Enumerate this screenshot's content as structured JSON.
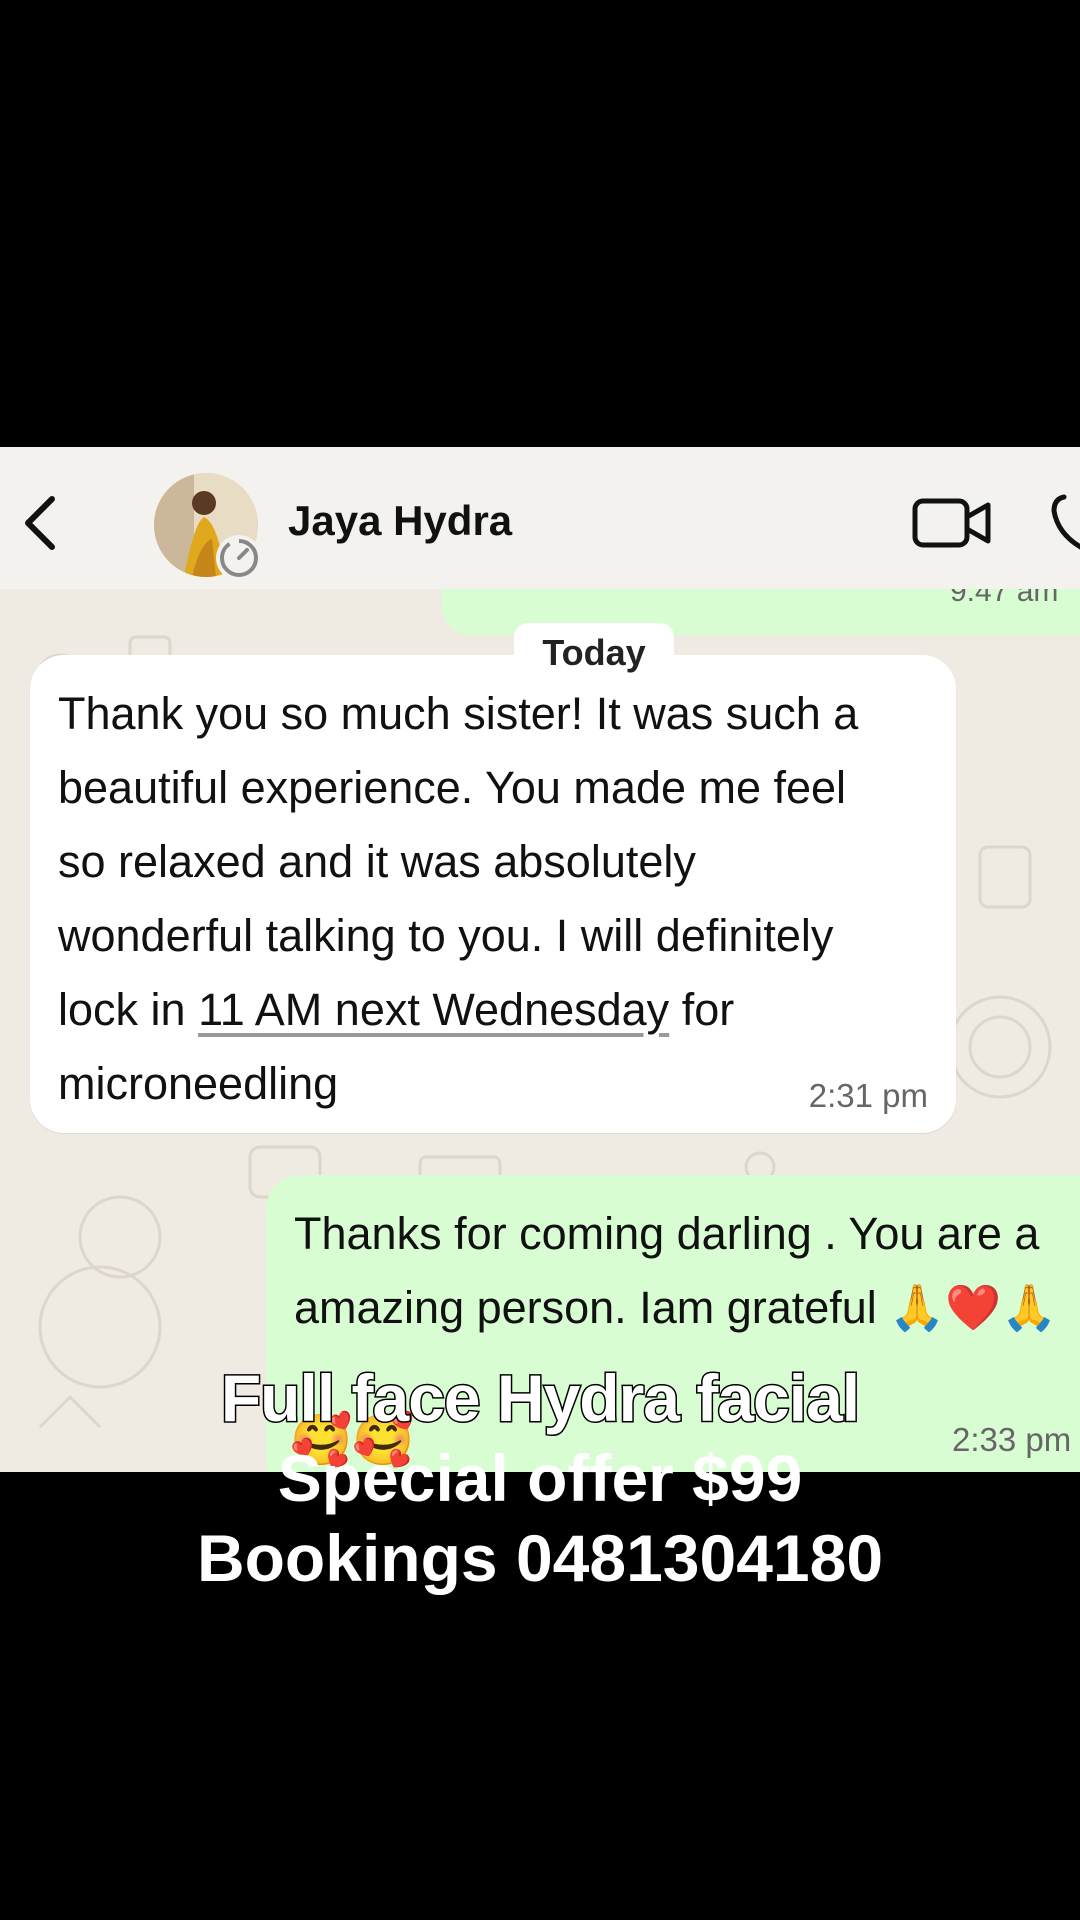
{
  "header": {
    "contact_name": "Jaya Hydra",
    "back_icon": "chevron-left-icon",
    "video_icon": "video-camera-icon",
    "phone_icon": "phone-icon"
  },
  "chat": {
    "previous_message_time_partial": "9:47 am",
    "date_label": "Today",
    "incoming_message": {
      "text_before": "Thank you so much sister! It was such a\nbeautiful experience. You made me feel\nso relaxed and it was absolutely\nwonderful talking to you. I will definitely\nlock in ",
      "link_text": "11 AM next Wednesday",
      "text_after": " for\nmicroneedling",
      "time": "2:31 pm"
    },
    "outgoing_message": {
      "line1": "Thanks for coming darling . You are a",
      "line2": "amazing person. Iam grateful 🙏❤️🙏",
      "emoji_line": "🥰🥰",
      "time": "2:33 pm"
    }
  },
  "overlay": {
    "line1": "Full face Hydra facial",
    "line2": "Special offer $99",
    "line3": "Bookings 0481304180"
  },
  "colors": {
    "chat_background": "#efeae2",
    "outgoing_bubble": "#d9fdd3",
    "incoming_bubble": "#ffffff",
    "page_background": "#000000"
  }
}
